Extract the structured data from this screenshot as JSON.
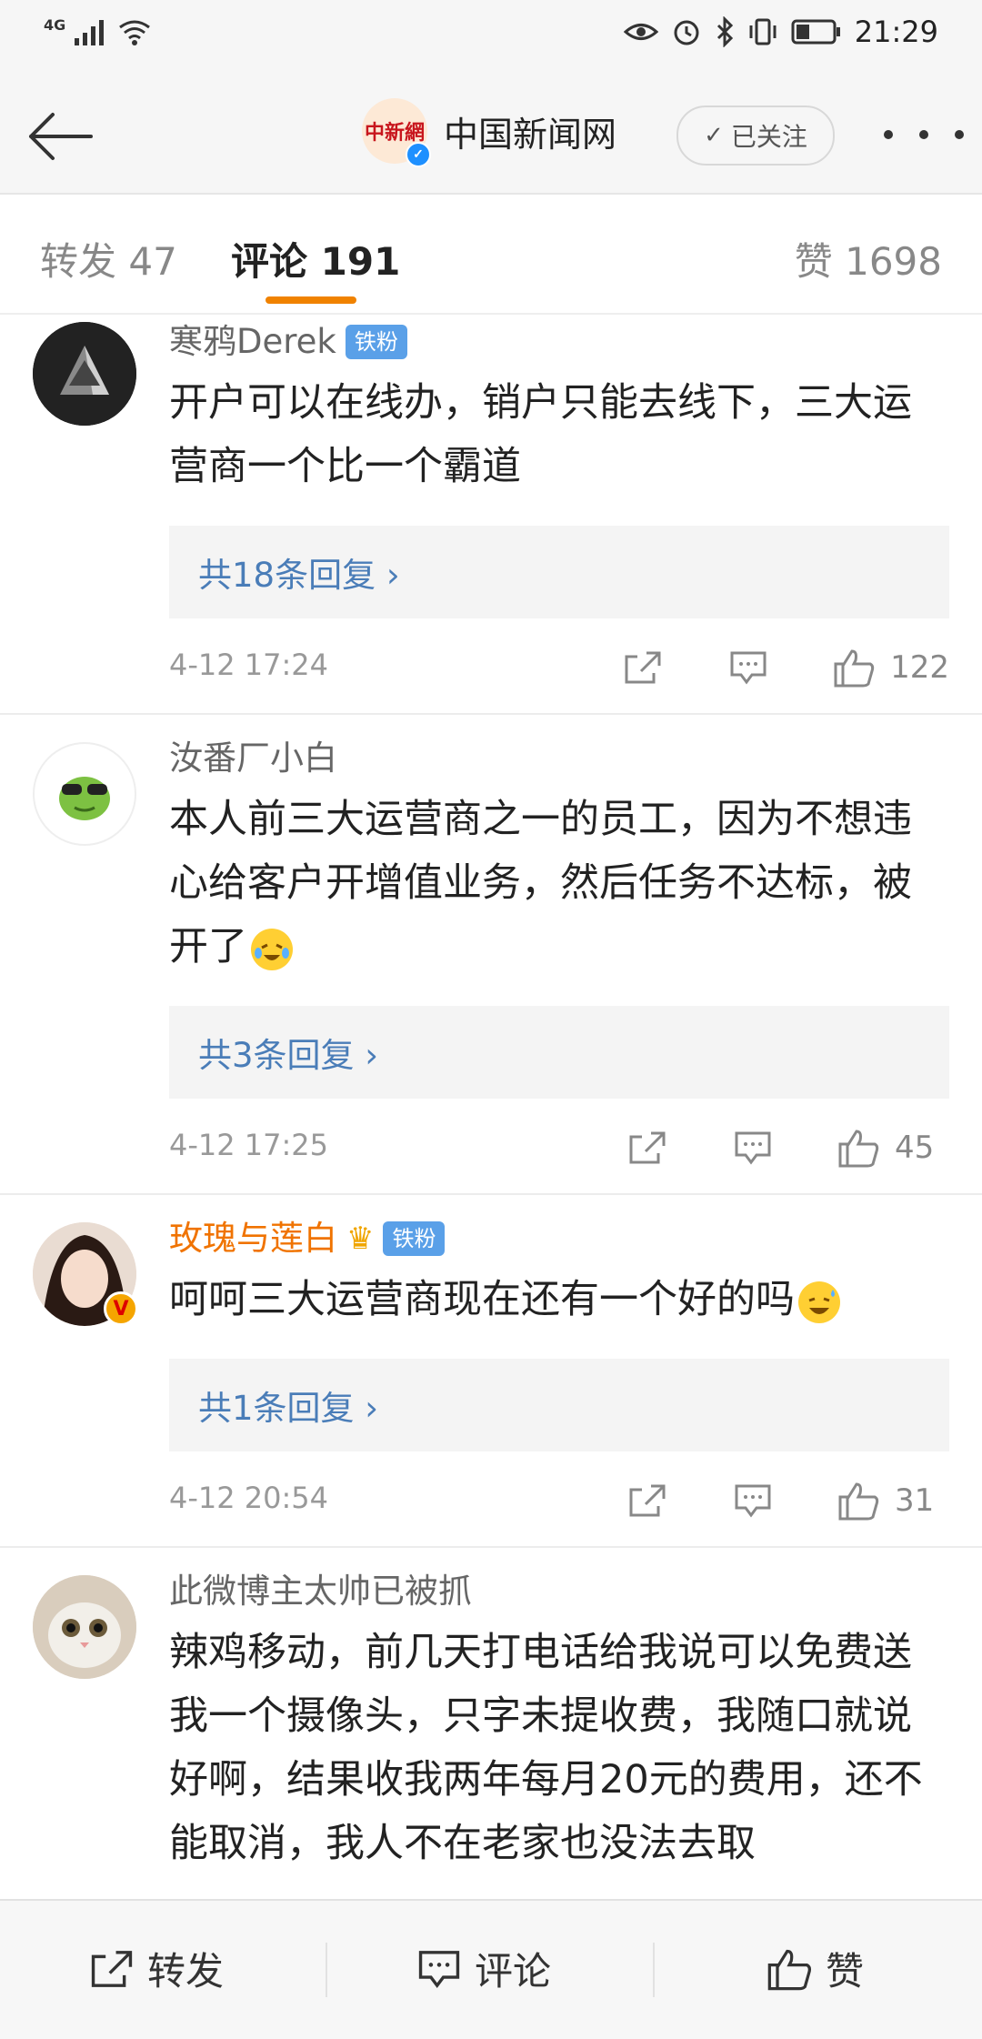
{
  "status_bar": {
    "network": "4G",
    "time": "21:29"
  },
  "header": {
    "account_name": "中国新闻网",
    "logo_text": "中新網",
    "follow_label": "已关注"
  },
  "tabs": {
    "repost": "转发 47",
    "comments": "评论 191",
    "likes": "赞 1698"
  },
  "comments": [
    {
      "user": "寒鸦Derek",
      "badge": "铁粉",
      "text": "开户可以在线办，销户只能去线下，三大运营商一个比一个霸道",
      "replies": "共18条回复 ›",
      "time": "4-12 17:24",
      "likes": "122"
    },
    {
      "user": "汝番厂小白",
      "text": "本人前三大运营商之一的员工，因为不想违心给客户开增值业务，然后任务不达标，被开了",
      "replies": "共3条回复 ›",
      "time": "4-12 17:25",
      "likes": "45"
    },
    {
      "user": "玫瑰与莲白",
      "badge": "铁粉",
      "text": "呵呵三大运营商现在还有一个好的吗",
      "replies": "共1条回复 ›",
      "time": "4-12 20:54",
      "likes": "31"
    },
    {
      "user": "此微博主太帅已被抓",
      "text": "辣鸡移动，前几天打电话给我说可以免费送我一个摄像头，只字未提收费，我随口就说好啊，结果收我两年每月20元的费用，还不能取消，我人不在老家也没法去取"
    }
  ],
  "bottom_bar": {
    "repost": "转发",
    "comment": "评论",
    "like": "赞"
  },
  "colors": {
    "accent": "#f08200",
    "link": "#4a7db8",
    "vip_name": "#f07300",
    "badge": "#5aa0e8"
  }
}
